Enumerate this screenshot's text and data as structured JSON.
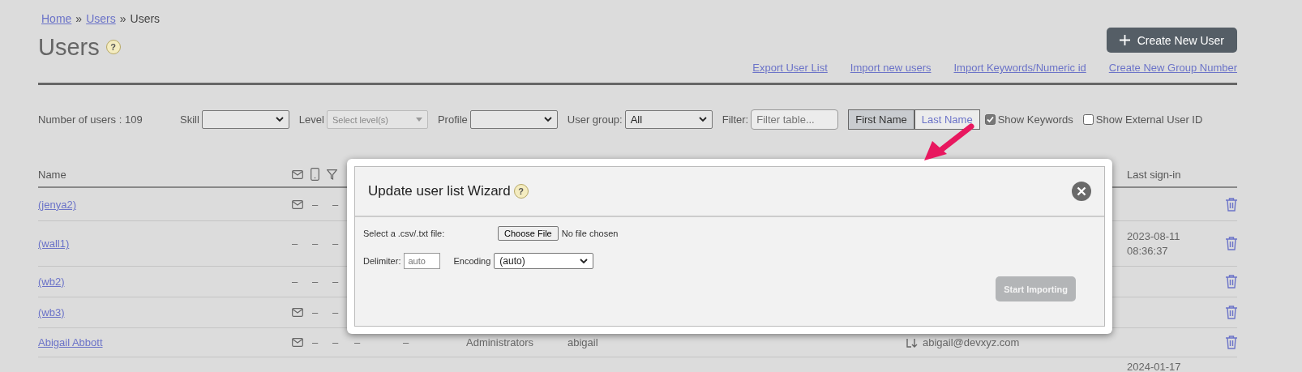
{
  "breadcrumb": [
    {
      "label": "Home",
      "link": true
    },
    {
      "label": "»",
      "link": false
    },
    {
      "label": "Users",
      "link": true
    },
    {
      "label": "»",
      "link": false
    },
    {
      "label": "Users",
      "link": false
    }
  ],
  "title": "Users",
  "title_help": "?",
  "create_button": "Create New User",
  "links": [
    "Export User List",
    "Import new users",
    "Import Keywords/Numeric id",
    "Create New Group Number"
  ],
  "filters": {
    "count": "Number of users : 109",
    "selects": [
      {
        "label": "Skill",
        "kind": "select"
      },
      {
        "label": "Level",
        "placeholder": "Select level(s)",
        "kind": "multi",
        "disabled": true
      },
      {
        "label": "Profile",
        "kind": "select"
      },
      {
        "label": "User group:",
        "value": "All",
        "kind": "select"
      }
    ],
    "filter": {
      "label": "Filter:",
      "placeholder": "Filter table..."
    },
    "name_toggle": [
      {
        "label": "First Name",
        "selected": true
      },
      {
        "label": "Last Name",
        "selected": false
      }
    ],
    "checkboxes": [
      {
        "label": "Show Keywords",
        "checked": true
      },
      {
        "label": "Show External User ID",
        "checked": false
      }
    ]
  },
  "table": {
    "name_header": "Name",
    "last_header": "Last sign-in",
    "rows": [
      {
        "name": "(jenya2)",
        "cells": [
          {
            "kind": "mail"
          },
          {
            "kind": "text",
            "text": "–"
          },
          {
            "kind": "text",
            "text": "–"
          }
        ]
      },
      {
        "name": "(wall1)",
        "cells": [
          {
            "kind": "text",
            "text": "–"
          },
          {
            "kind": "text",
            "text": "–"
          },
          {
            "kind": "text",
            "text": "–"
          }
        ],
        "last_sign_in": "2023-08-11 08:36:37"
      },
      {
        "name": "(wb2)",
        "cells": [
          {
            "kind": "text",
            "text": "–"
          },
          {
            "kind": "text",
            "text": "–"
          },
          {
            "kind": "text",
            "text": "–"
          }
        ]
      },
      {
        "name": "(wb3)",
        "cells": [
          {
            "kind": "mail"
          },
          {
            "kind": "text",
            "text": "–"
          },
          {
            "kind": "text",
            "text": "–"
          }
        ]
      },
      {
        "name": "Abigail Abbott",
        "cells": [
          {
            "kind": "mail"
          },
          {
            "kind": "text",
            "text": "–"
          },
          {
            "kind": "text",
            "text": "–"
          },
          {
            "kind": "text",
            "text": "–"
          },
          {
            "kind": "text",
            "text": "–"
          },
          {
            "kind": "text",
            "text": "Administrators"
          },
          {
            "kind": "text",
            "text": "abigail"
          },
          {
            "kind": "email",
            "text": "abigail@devxyz.com"
          }
        ]
      },
      {
        "cells": [],
        "last_sign_in": "2024-01-17"
      }
    ]
  },
  "modal": {
    "title": "Update user list Wizard",
    "help": "?",
    "file_label": "Select a .csv/.txt file:",
    "file_button": "Choose File",
    "file_status": "No file chosen",
    "delimiter": {
      "label": "Delimiter:",
      "placeholder": "auto"
    },
    "encoding": {
      "label": "Encoding",
      "value": "(auto)"
    },
    "submit": {
      "label": "Start Importing",
      "disabled": true
    }
  }
}
